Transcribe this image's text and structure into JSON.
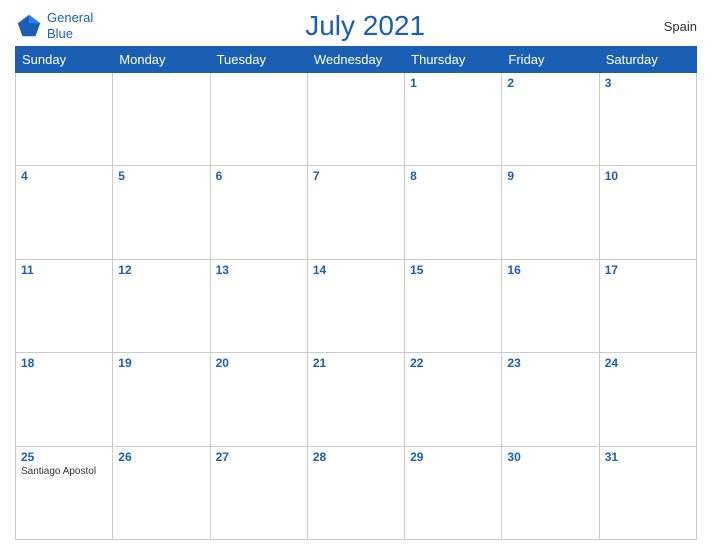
{
  "header": {
    "title": "July 2021",
    "country": "Spain",
    "logo_line1": "General",
    "logo_line2": "Blue"
  },
  "weekdays": [
    "Sunday",
    "Monday",
    "Tuesday",
    "Wednesday",
    "Thursday",
    "Friday",
    "Saturday"
  ],
  "weeks": [
    [
      {
        "date": "",
        "events": []
      },
      {
        "date": "",
        "events": []
      },
      {
        "date": "",
        "events": []
      },
      {
        "date": "",
        "events": []
      },
      {
        "date": "1",
        "events": []
      },
      {
        "date": "2",
        "events": []
      },
      {
        "date": "3",
        "events": []
      }
    ],
    [
      {
        "date": "4",
        "events": []
      },
      {
        "date": "5",
        "events": []
      },
      {
        "date": "6",
        "events": []
      },
      {
        "date": "7",
        "events": []
      },
      {
        "date": "8",
        "events": []
      },
      {
        "date": "9",
        "events": []
      },
      {
        "date": "10",
        "events": []
      }
    ],
    [
      {
        "date": "11",
        "events": []
      },
      {
        "date": "12",
        "events": []
      },
      {
        "date": "13",
        "events": []
      },
      {
        "date": "14",
        "events": []
      },
      {
        "date": "15",
        "events": []
      },
      {
        "date": "16",
        "events": []
      },
      {
        "date": "17",
        "events": []
      }
    ],
    [
      {
        "date": "18",
        "events": []
      },
      {
        "date": "19",
        "events": []
      },
      {
        "date": "20",
        "events": []
      },
      {
        "date": "21",
        "events": []
      },
      {
        "date": "22",
        "events": []
      },
      {
        "date": "23",
        "events": []
      },
      {
        "date": "24",
        "events": []
      }
    ],
    [
      {
        "date": "25",
        "events": [
          "Santiago Apostol"
        ]
      },
      {
        "date": "26",
        "events": []
      },
      {
        "date": "27",
        "events": []
      },
      {
        "date": "28",
        "events": []
      },
      {
        "date": "29",
        "events": []
      },
      {
        "date": "30",
        "events": []
      },
      {
        "date": "31",
        "events": []
      }
    ]
  ]
}
